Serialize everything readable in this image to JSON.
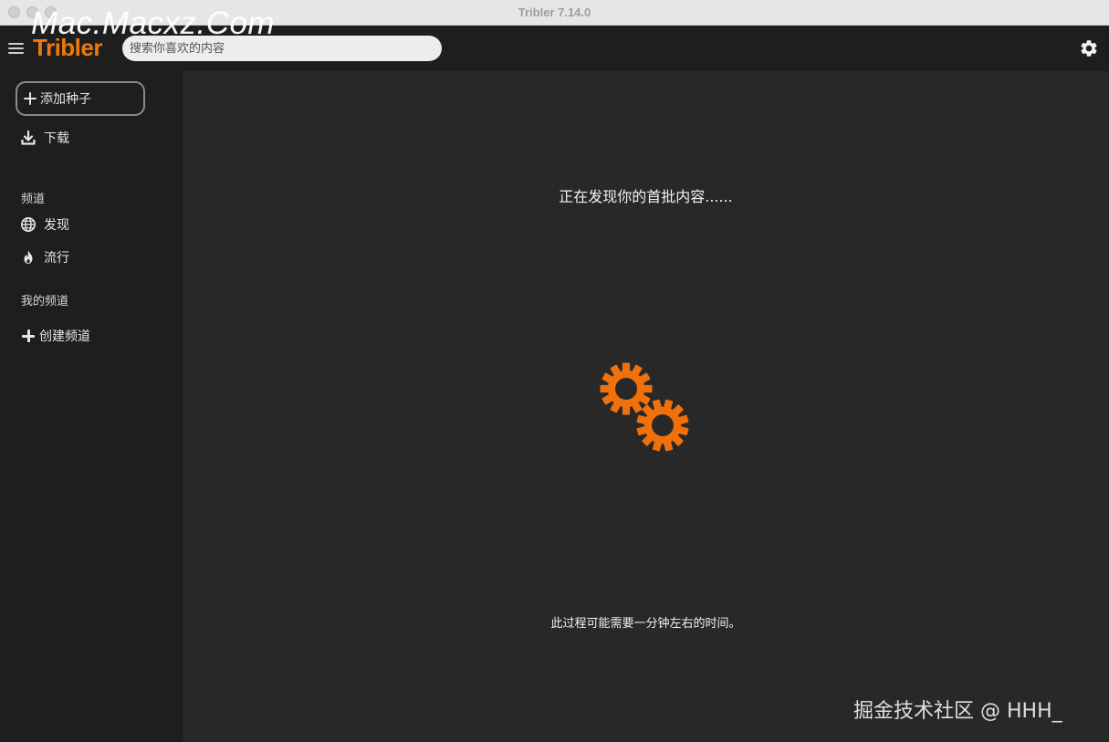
{
  "window": {
    "title": "Tribler 7.14.0"
  },
  "header": {
    "logo": "Tribler",
    "search_placeholder": "搜索你喜欢的内容",
    "watermark": "Mac.Macxz.Com"
  },
  "sidebar": {
    "add_torrent_label": "添加种子",
    "downloads_label": "下载",
    "channels_section": "频道",
    "discover_label": "发现",
    "popular_label": "流行",
    "my_channels_section": "我的频道",
    "create_channel_label": "创建频道"
  },
  "main": {
    "discovering_text": "正在发现你的首批内容......",
    "hint_text": "此过程可能需要一分钟左右的时间。"
  },
  "watermark_bottom": "掘金技术社区 @ HHH_",
  "colors": {
    "accent": "#f0780a",
    "background": "#282828",
    "sidebar": "#1e1e1e"
  },
  "icons": [
    "menu-icon",
    "settings-gear-icon",
    "plus-icon",
    "download-icon",
    "globe-icon",
    "fire-icon",
    "loading-gears-icon"
  ]
}
